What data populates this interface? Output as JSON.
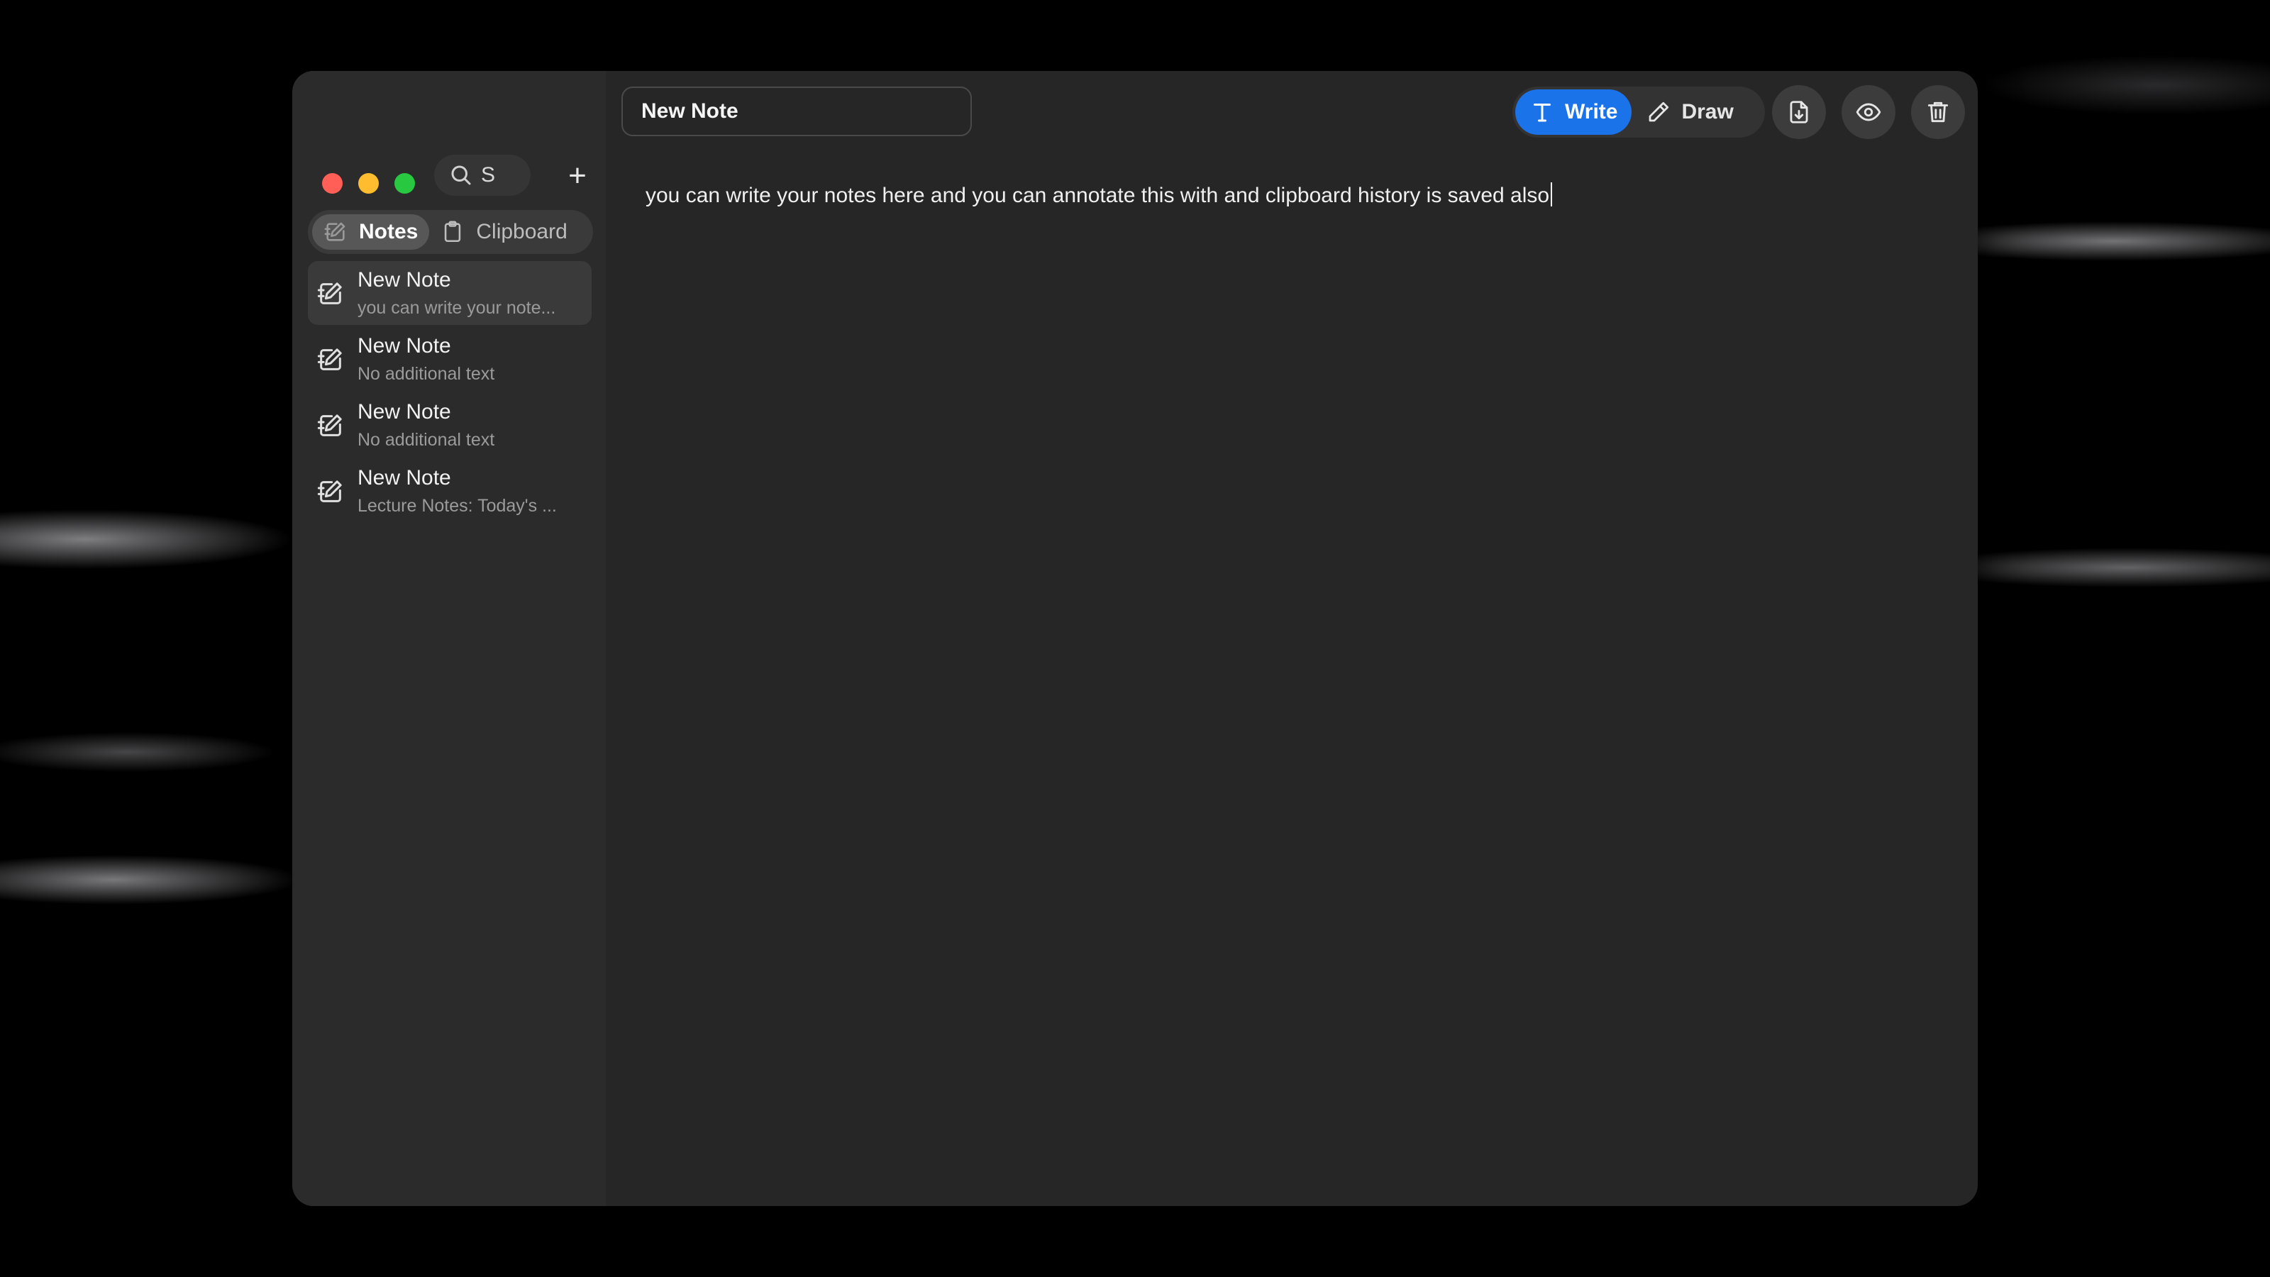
{
  "sidebar": {
    "search": {
      "value": "S",
      "icon": "search-icon"
    },
    "add_icon": "plus-icon",
    "add_symbol": "+",
    "tabs": [
      {
        "label": "Notes",
        "icon": "notes-icon",
        "active": true
      },
      {
        "label": "Clipboard",
        "icon": "clipboard-icon",
        "active": false
      }
    ],
    "notes": [
      {
        "title": "New Note",
        "preview": "you can write your note...",
        "selected": true
      },
      {
        "title": "New Note",
        "preview": "No additional text",
        "selected": false
      },
      {
        "title": "New Note",
        "preview": "No additional text",
        "selected": false
      },
      {
        "title": "New Note",
        "preview": "Lecture Notes: Today's ...",
        "selected": false
      }
    ]
  },
  "toolbar": {
    "title_value": "New Note",
    "write_label": "Write",
    "draw_label": "Draw",
    "active_mode": "Write",
    "export_icon": "file-download-icon",
    "preview_icon": "eye-icon",
    "delete_icon": "trash-icon",
    "accent_color": "#1a73e8"
  },
  "editor": {
    "text": "you can write your notes here and you can annotate this with  and clipboard history is saved also"
  },
  "colors": {
    "window_bg": "#262626",
    "traffic_red": "#ff5f57",
    "traffic_yellow": "#febc2e",
    "traffic_green": "#28c840"
  }
}
